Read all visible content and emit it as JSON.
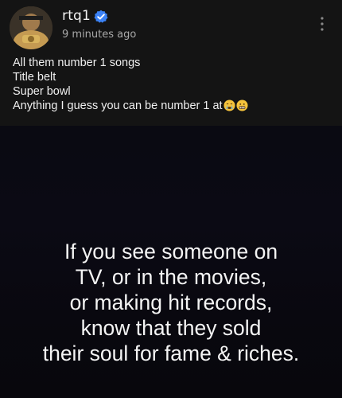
{
  "post": {
    "username": "rtq1",
    "timestamp": "9 minutes ago",
    "caption": [
      "All them number 1 songs",
      "Title belt",
      "Super bowl",
      "Anything I guess you can be number 1 at"
    ],
    "caption_emojis": [
      "crying-face-emoji",
      "grimacing-face-emoji"
    ]
  },
  "meme": {
    "lines": [
      "If you see someone on",
      "TV, or in the movies,",
      "or making hit records,",
      "know that they sold",
      "their soul for fame & riches."
    ]
  },
  "colors": {
    "background": "#121212",
    "verified_badge": "#3b82f6",
    "text_primary": "#f2f2f2",
    "text_secondary": "#a9a9a9"
  }
}
